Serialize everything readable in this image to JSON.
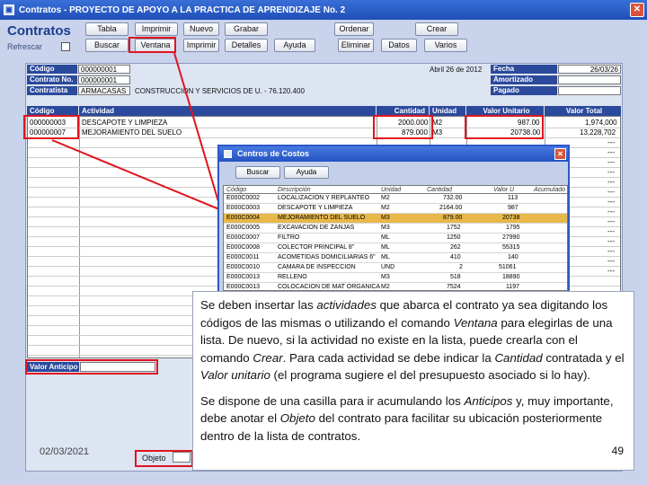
{
  "window": {
    "title": "Contratos - PROYECTO DE APOYO A LA PRACTICA DE APRENDIZAJE No. 2"
  },
  "header": {
    "brand": "Contratos",
    "refresh_label": "Refrescar"
  },
  "toolbar": {
    "row1": [
      "Tabla",
      "Imprimir",
      "Nuevo",
      "Grabar",
      "Ordenar",
      "Crear"
    ],
    "row2": [
      "Buscar",
      "Ventana",
      "Imprimir",
      "Detalles",
      "Ayuda",
      "Eliminar",
      "Datos",
      "Varios"
    ]
  },
  "contract": {
    "codigo_label": "Código",
    "codigo_value": "000000001",
    "contrato_label": "Contrato No.",
    "contrato_value": "000000001",
    "contratista_label": "Contratista",
    "contratista_value": "ARMACASAS",
    "contratista_desc": "CONSTRUCCION Y SERVICIOS DE U. - 76.120.400",
    "date_text": "Abril 26 de 2012",
    "fecha_label": "Fecha",
    "fecha_value": "26/03/26",
    "amortizado_label": "Amortizado",
    "pagado_label": "Pagado"
  },
  "grid": {
    "headers": {
      "codigo": "Código",
      "actividad": "Actividad",
      "cantidad": "Cantidad",
      "unidad": "Unidad",
      "valor_unitario": "Valor Unitario",
      "valor_total": "Valor Total"
    },
    "rows": [
      {
        "codigo": "000000003",
        "actividad": "DESCAPOTE Y LIMPIEZA",
        "cantidad": "2000.000",
        "unidad": "M2",
        "valor_unitario": "987.00",
        "valor_total": "1,974,000"
      },
      {
        "codigo": "000000007",
        "actividad": "MEJORAMIENTO DEL SUELO",
        "cantidad": "879.000",
        "unidad": "M3",
        "valor_unitario": "20738.00",
        "valor_total": "13,228,702"
      }
    ],
    "empty_total": "---"
  },
  "valor_anticipo_label": "Valor Anticipo",
  "objeto_label": "Objeto",
  "footer_date": "02/03/2021",
  "dialog": {
    "title": "Centros de Costos",
    "buttons": [
      "Buscar",
      "Ayuda"
    ],
    "headers": {
      "codigo": "Código",
      "descripcion": "Descripción",
      "unidad": "Unidad",
      "cantidad": "Cantidad",
      "valor": "Valor U",
      "acumulado": "Acumulado"
    },
    "rows": [
      {
        "codigo": "E000C0002",
        "descripcion": "LOCALIZACION Y REPLANTEO",
        "unidad": "M2",
        "cantidad": "732.00",
        "valor": "113"
      },
      {
        "codigo": "E000C0003",
        "descripcion": "DESCAPOTE Y LIMPIEZA",
        "unidad": "M2",
        "cantidad": "2164.00",
        "valor": "987"
      },
      {
        "codigo": "E000C0004",
        "descripcion": "MEJORAMIENTO DEL SUELO",
        "unidad": "M3",
        "cantidad": "879.00",
        "valor": "20738"
      },
      {
        "codigo": "E000C0005",
        "descripcion": "EXCAVACION DE ZANJAS",
        "unidad": "M3",
        "cantidad": "1752",
        "valor": "1795"
      },
      {
        "codigo": "E000C0007",
        "descripcion": "FILTRO",
        "unidad": "ML",
        "cantidad": "1250",
        "valor": "27990"
      },
      {
        "codigo": "E000C0008",
        "descripcion": "COLECTOR PRINCIPAL 8\"",
        "unidad": "ML",
        "cantidad": "262",
        "valor": "55315"
      },
      {
        "codigo": "E000C0011",
        "descripcion": "ACOMETIDAS DOMICILIARIAS 6\"",
        "unidad": "ML",
        "cantidad": "410",
        "valor": "140"
      },
      {
        "codigo": "E000C0010",
        "descripcion": "CAMARA DE INSPECCION",
        "unidad": "UND",
        "cantidad": "2",
        "valor": "51061"
      },
      {
        "codigo": "E000C0013",
        "descripcion": "RELLENO",
        "unidad": "M3",
        "cantidad": "518",
        "valor": "18890"
      },
      {
        "codigo": "E000C0013",
        "descripcion": "COLOCACION DE MAT ORGANICA",
        "unidad": "M2",
        "cantidad": "7524",
        "valor": "1197"
      }
    ]
  },
  "callout": {
    "p1_a": "Se deben insertar las ",
    "p1_b": "actividades",
    "p1_c": " que abarca el contrato ya sea digitando los códigos de las mismas o utilizando el comando ",
    "p1_d": "Ventana",
    "p1_e": " para elegirlas de una lista. De nuevo, si la actividad no existe en la lista, puede crearla con el comando ",
    "p1_f": "Crear",
    "p1_g": ". Para cada actividad se debe indicar la ",
    "p1_h": "Cantidad",
    "p1_i": " contratada y el ",
    "p1_j": "Valor unitario",
    "p1_k": " (el programa sugiere el del presupuesto asociado si lo hay).",
    "p2_a": "Se dispone de una casilla para ir acumulando los ",
    "p2_b": "Anticipos",
    "p2_c": " y, muy importante, debe anotar el ",
    "p2_d": "Objeto",
    "p2_e": " del contrato para facilitar su ubicación posteriormente dentro de la lista de contratos.",
    "page_number": "49"
  },
  "colors": {
    "accent": "#2c4a9c",
    "highlight": "#e0141e",
    "selected_row": "#e8b84a"
  }
}
